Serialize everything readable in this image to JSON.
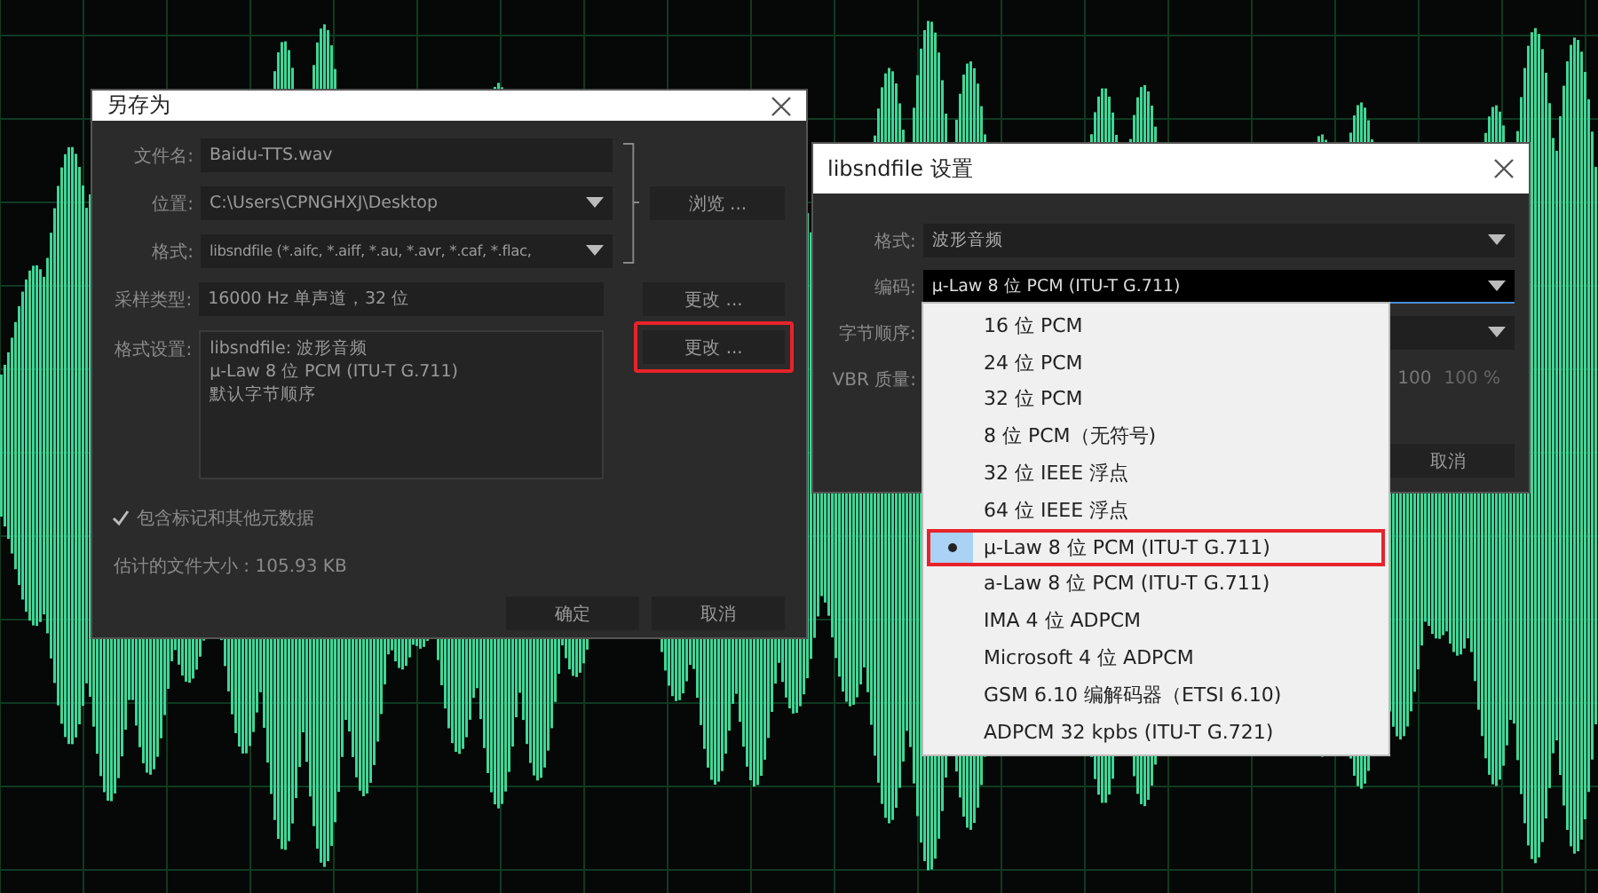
{
  "save_dialog": {
    "title": "另存为",
    "fields": [
      {
        "label": "文件名:",
        "value": "Baidu-TTS.wav",
        "kind": "text"
      },
      {
        "label": "位置:",
        "value": "C:\\Users\\CPNGHXJ\\Desktop",
        "kind": "dropdown"
      },
      {
        "label": "格式:",
        "value": "libsndfile (*.aifc, *.aiff, *.au, *.avr, *.caf, *.flac,",
        "kind": "dropdown"
      }
    ],
    "browse_button": "浏览 ...",
    "sample_type": {
      "label": "采样类型:",
      "value": "16000 Hz 单声道，32 位",
      "button": "更改 ...",
      "highlighted": false
    },
    "format_settings": {
      "label": "格式设置:",
      "lines": [
        "libsndfile: 波形音频",
        "µ-Law 8 位 PCM (ITU-T G.711)",
        "默认字节顺序"
      ],
      "button": "更改 ...",
      "highlighted": true
    },
    "metadata_checkbox": {
      "label": "包含标记和其他元数据",
      "checked": true
    },
    "estimated_size": "估计的文件大小 : 105.93 KB",
    "buttons": [
      "确定",
      "取消"
    ]
  },
  "settings_dialog": {
    "title": "libsndfile 设置",
    "rows": [
      {
        "label": "格式:",
        "value": "波形音频",
        "focused": false
      },
      {
        "label": "编码:",
        "value": "µ-Law 8 位 PCM (ITU-T G.711)",
        "focused": true
      },
      {
        "label": "字节顺序:",
        "value": "",
        "focused": false
      }
    ],
    "vbr": {
      "label": "VBR 质量:",
      "reading_1": "100",
      "reading_2": "100 %"
    },
    "cancel_button": "取消"
  },
  "encoding_menu": [
    {
      "label": "16 位 PCM",
      "selected": false,
      "highlighted": false
    },
    {
      "label": "24 位 PCM",
      "selected": false,
      "highlighted": false
    },
    {
      "label": "32 位 PCM",
      "selected": false,
      "highlighted": false
    },
    {
      "label": "8 位 PCM（无符号)",
      "selected": false,
      "highlighted": false
    },
    {
      "label": "32 位 IEEE 浮点",
      "selected": false,
      "highlighted": false
    },
    {
      "label": "64 位 IEEE 浮点",
      "selected": false,
      "highlighted": false
    },
    {
      "label": "µ-Law 8 位 PCM (ITU-T G.711)",
      "selected": true,
      "highlighted": true
    },
    {
      "label": "a-Law 8 位 PCM (ITU-T G.711)",
      "selected": false,
      "highlighted": false
    },
    {
      "label": "IMA 4 位 ADPCM",
      "selected": false,
      "highlighted": false
    },
    {
      "label": "Microsoft 4 位 ADPCM",
      "selected": false,
      "highlighted": false
    },
    {
      "label": "GSM 6.10 编解码器（ETSI 6.10)",
      "selected": false,
      "highlighted": false
    },
    {
      "label": "ADPCM 32 kpbs (ITU-T G.721)",
      "selected": false,
      "highlighted": false
    }
  ]
}
